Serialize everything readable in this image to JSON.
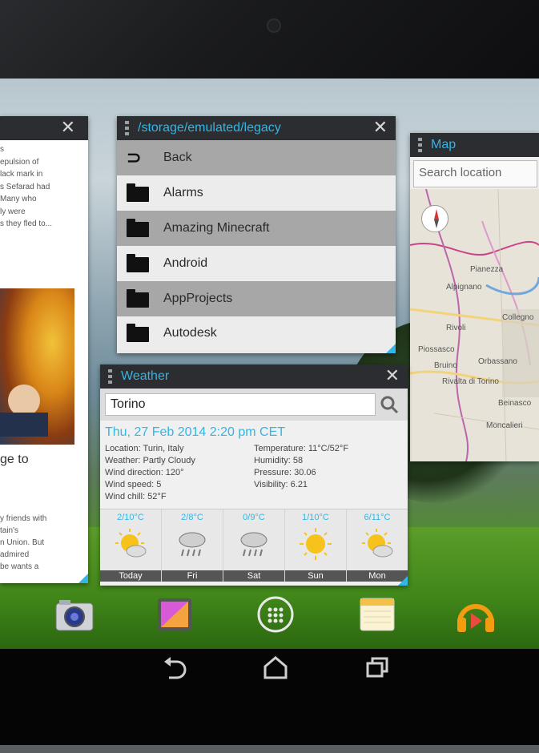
{
  "colors": {
    "accent": "#33b5e5",
    "titlebar": "#2b2d31",
    "row_dark": "#a7a7a7",
    "row_light": "#ececec"
  },
  "news": {
    "close_icon": "✕",
    "text_top": [
      "s",
      "",
      "epulsion of",
      "lack mark in",
      "s Sefarad had",
      "Many who",
      "ly were",
      "s they fled to..."
    ],
    "heading": "ge to",
    "text_bottom": [
      "y friends with",
      "tain's",
      "n Union. But",
      "admired",
      "be wants a"
    ]
  },
  "files": {
    "title": "/storage/emulated/legacy",
    "close_icon": "✕",
    "items": [
      {
        "label": "Back",
        "icon": "back-arrow-icon"
      },
      {
        "label": "Alarms",
        "icon": "folder-icon"
      },
      {
        "label": "Amazing Minecraft",
        "icon": "folder-icon"
      },
      {
        "label": "Android",
        "icon": "folder-icon"
      },
      {
        "label": "AppProjects",
        "icon": "folder-icon"
      },
      {
        "label": "Autodesk",
        "icon": "folder-icon"
      }
    ]
  },
  "map": {
    "title": "Map",
    "search_placeholder": "Search location",
    "places": [
      "Pianezza",
      "Alpignano",
      "Rivoli",
      "Collegno",
      "Piossasco",
      "Bruino",
      "Orbassano",
      "Rivalta di Torino",
      "Beinasco",
      "Moncalieri"
    ]
  },
  "weather": {
    "title": "Weather",
    "close_icon": "✕",
    "city": "Torino",
    "date": "Thu, 27 Feb 2014 2:20 pm CET",
    "left": [
      "Location: Turin, Italy",
      "Weather: Partly Cloudy",
      "Wind direction: 120°",
      "Wind speed: 5",
      "Wind chill: 52°F"
    ],
    "right": [
      "Temperature: 11°C/52°F",
      "Humidity: 58",
      "Pressure: 30.06",
      "Visibility: 6.21"
    ],
    "forecast": [
      {
        "day": "Today",
        "temp": "2/10°C",
        "icon": "partly-cloudy-icon"
      },
      {
        "day": "Fri",
        "temp": "2/8°C",
        "icon": "rain-icon"
      },
      {
        "day": "Sat",
        "temp": "0/9°C",
        "icon": "rain-icon"
      },
      {
        "day": "Sun",
        "temp": "1/10°C",
        "icon": "sunny-icon"
      },
      {
        "day": "Mon",
        "temp": "6/11°C",
        "icon": "partly-cloudy-icon"
      }
    ]
  },
  "dock": [
    "camera-icon",
    "gallery-icon",
    "apps-icon",
    "notes-icon",
    "music-icon"
  ],
  "nav": [
    "back-icon",
    "home-icon",
    "recents-icon"
  ]
}
